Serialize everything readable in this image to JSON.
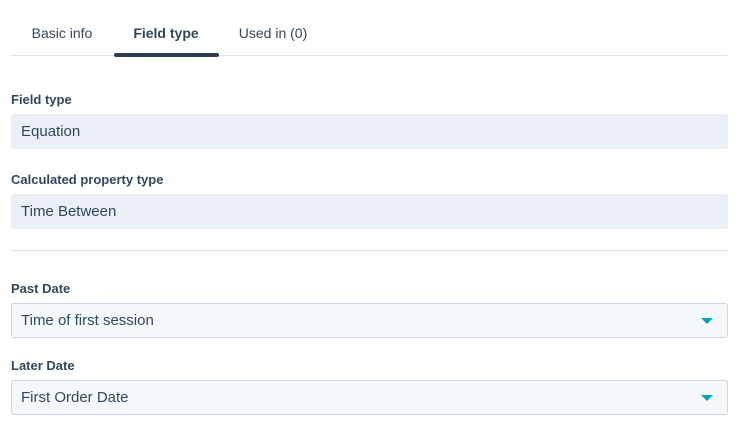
{
  "tabs": [
    {
      "label": "Basic info"
    },
    {
      "label": "Field type"
    },
    {
      "label": "Used in (0)"
    }
  ],
  "active_tab": "Field type",
  "field_type": {
    "label": "Field type",
    "value": "Equation"
  },
  "calculated_property_type": {
    "label": "Calculated property type",
    "value": "Time Between"
  },
  "past_date": {
    "label": "Past Date",
    "value": "Time of first session"
  },
  "later_date": {
    "label": "Later Date",
    "value": "First Order Date"
  },
  "colors": {
    "accent_caret": "#00a4bd",
    "tab_indicator": "#2d3e50",
    "readonly_bg": "#eaf0f6",
    "text": "#33475b"
  },
  "icons": {
    "dropdown": "caret-down-icon"
  }
}
